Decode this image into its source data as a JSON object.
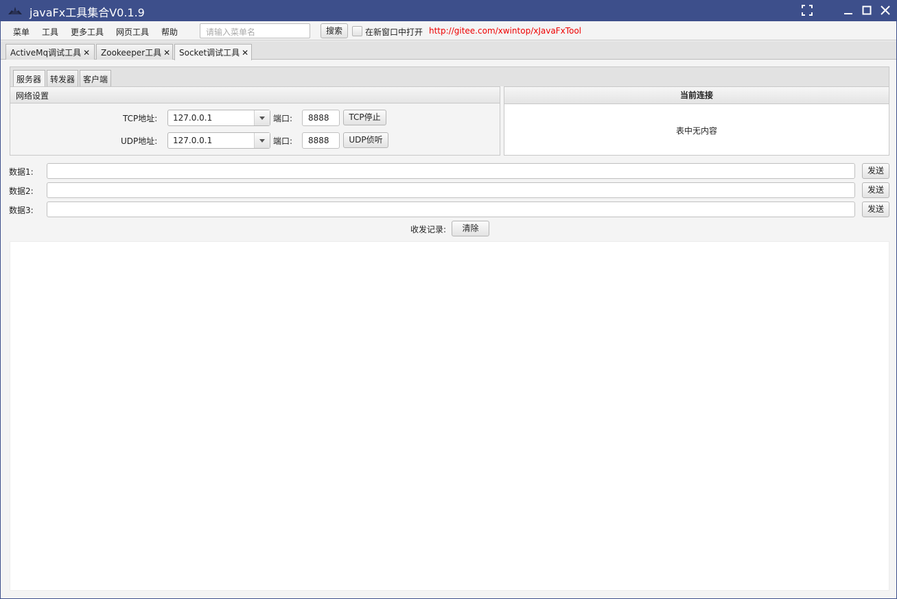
{
  "window": {
    "title": "javaFx工具集合V0.1.9"
  },
  "menubar": {
    "items": [
      "菜单",
      "工具",
      "更多工具",
      "网页工具",
      "帮助"
    ],
    "search_placeholder": "请输入菜单名",
    "search_button": "搜索",
    "new_window_checkbox_label": "在新窗口中打开",
    "link": "http://gitee.com/xwintop/xJavaFxTool"
  },
  "tabs": [
    {
      "label": "ActiveMq调试工具",
      "close": "✕"
    },
    {
      "label": "Zookeeper工具",
      "close": "✕"
    },
    {
      "label": "Socket调试工具",
      "close": "✕",
      "active": true
    }
  ],
  "subtabs": [
    "服务器",
    "转发器",
    "客户端"
  ],
  "network_settings": {
    "title": "网络设置",
    "tcp_label": "TCP地址:",
    "tcp_address": "127.0.0.1",
    "tcp_port_label": "端口:",
    "tcp_port": "8888",
    "tcp_button": "TCP停止",
    "udp_label": "UDP地址:",
    "udp_address": "127.0.0.1",
    "udp_port_label": "端口:",
    "udp_port": "8888",
    "udp_button": "UDP侦听"
  },
  "connections": {
    "header": "当前连接",
    "empty_text": "表中无内容"
  },
  "data_rows": [
    {
      "label": "数据1:",
      "value": "",
      "button": "发送"
    },
    {
      "label": "数据2:",
      "value": "",
      "button": "发送"
    },
    {
      "label": "数据3:",
      "value": "",
      "button": "发送"
    }
  ],
  "log": {
    "label": "收发记录:",
    "clear_button": "清除",
    "content": ""
  },
  "colors": {
    "titlebar": "#3d4f8b",
    "link": "#ee0000"
  }
}
